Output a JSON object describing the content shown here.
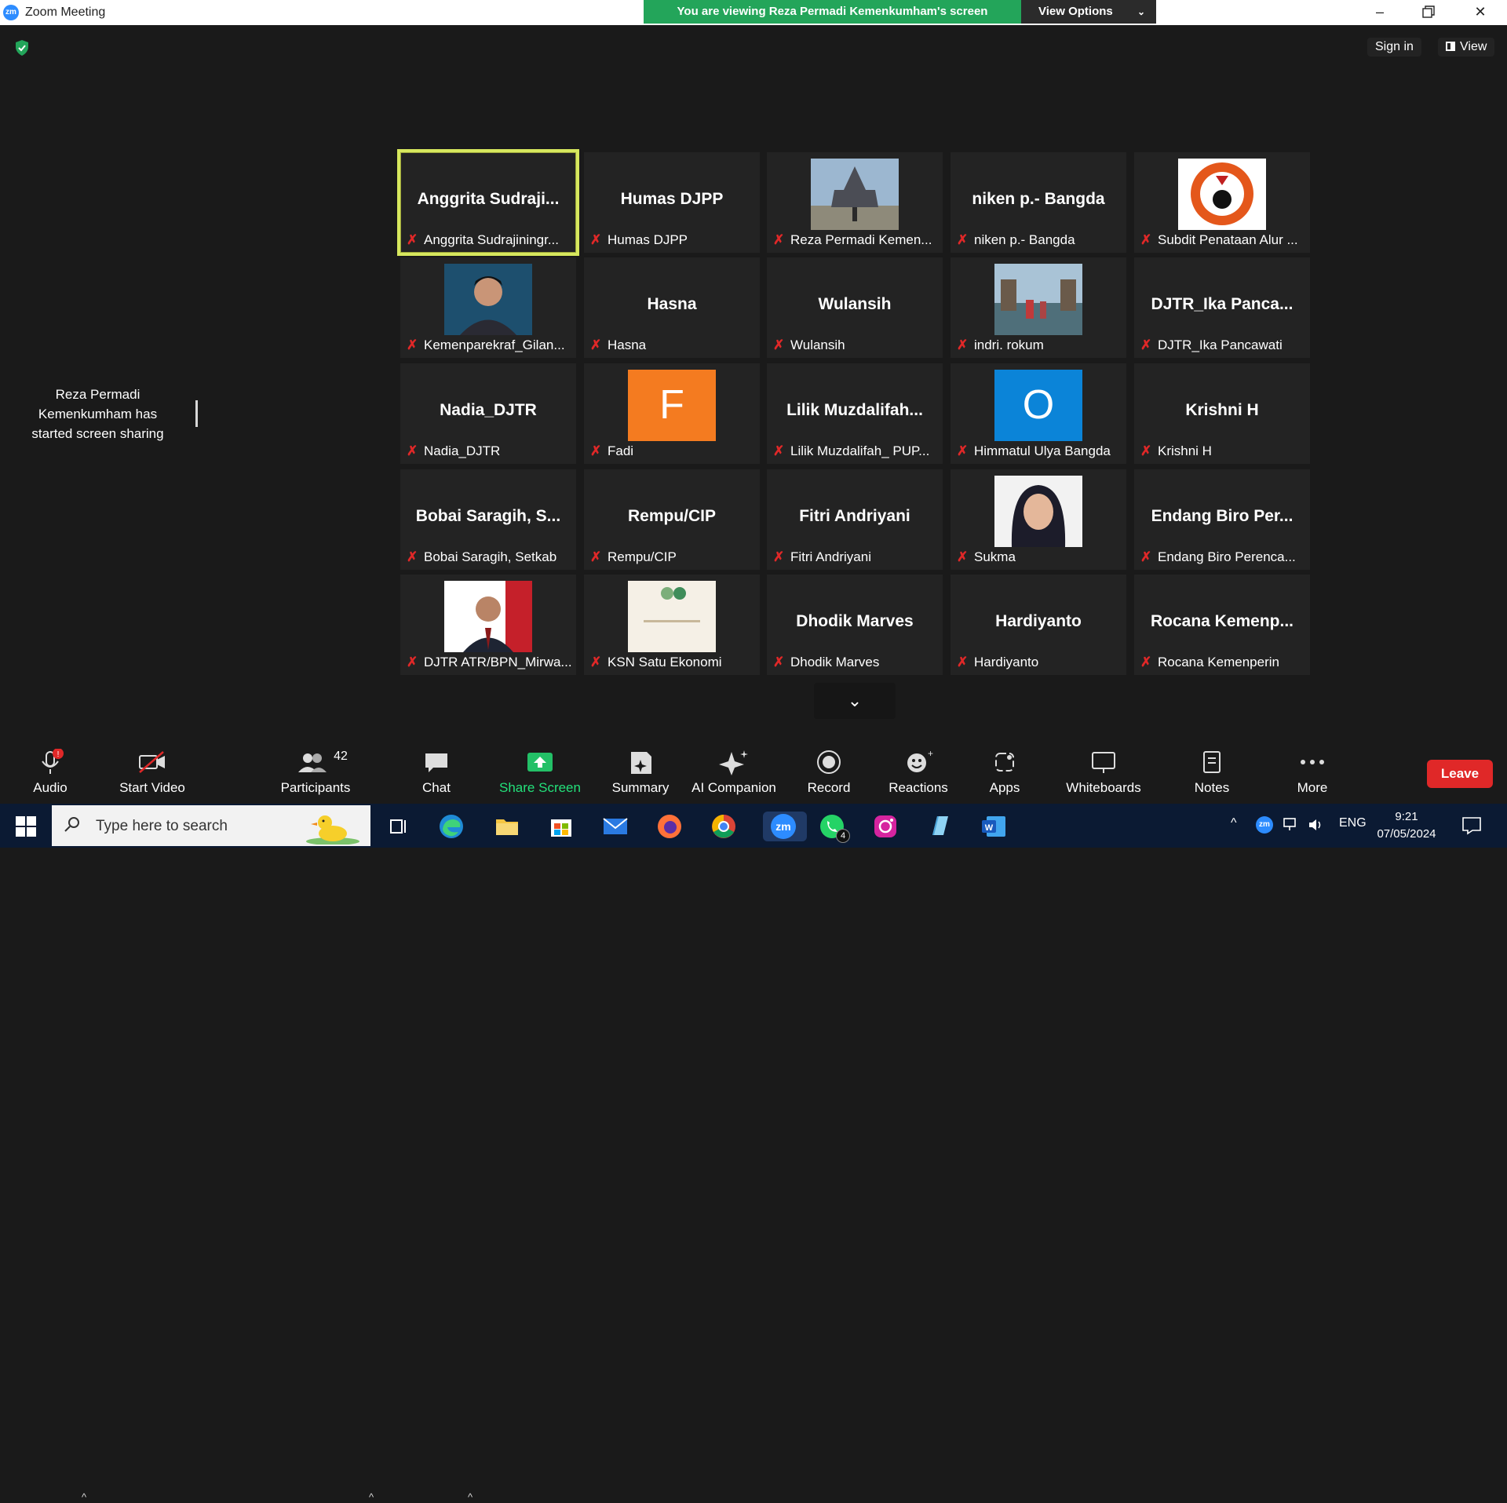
{
  "titlebar": {
    "app_logo": "zm",
    "title": "Zoom Meeting",
    "banner": "You are viewing Reza Permadi Kemenkumham's screen",
    "view_options": "View Options"
  },
  "topright": {
    "sign_in": "Sign in",
    "view": "View"
  },
  "notification": "Reza Permadi Kemenkumham has started screen sharing",
  "tiles": [
    {
      "name": "Anggrita Sudraji...",
      "caption": "Anggrita Sudrajiningr..."
    },
    {
      "name": "Humas DJPP",
      "caption": "Humas DJPP"
    },
    {
      "name": "",
      "caption": "Reza Permadi Kemen..."
    },
    {
      "name": "niken p.- Bangda",
      "caption": "niken p.- Bangda"
    },
    {
      "name": "",
      "caption": "Subdit Penataan Alur ..."
    },
    {
      "name": "",
      "caption": "Kemenparekraf_Gilan..."
    },
    {
      "name": "Hasna",
      "caption": "Hasna"
    },
    {
      "name": "Wulansih",
      "caption": "Wulansih"
    },
    {
      "name": "",
      "caption": "indri. rokum"
    },
    {
      "name": "DJTR_Ika Panca...",
      "caption": "DJTR_Ika Pancawati"
    },
    {
      "name": "Nadia_DJTR",
      "caption": "Nadia_DJTR"
    },
    {
      "name": "F",
      "caption": "Fadi"
    },
    {
      "name": "Lilik Muzdalifah...",
      "caption": "Lilik Muzdalifah_ PUP..."
    },
    {
      "name": "O",
      "caption": "Himmatul Ulya Bangda"
    },
    {
      "name": "Krishni H",
      "caption": "Krishni H"
    },
    {
      "name": "Bobai Saragih, S...",
      "caption": "Bobai Saragih, Setkab"
    },
    {
      "name": "Rempu/CIP",
      "caption": "Rempu/CIP"
    },
    {
      "name": "Fitri Andriyani",
      "caption": "Fitri Andriyani"
    },
    {
      "name": "",
      "caption": "Sukma"
    },
    {
      "name": "Endang Biro Per...",
      "caption": "Endang Biro Perenca..."
    },
    {
      "name": "",
      "caption": "DJTR ATR/BPN_Mirwa..."
    },
    {
      "name": "",
      "caption": "KSN Satu Ekonomi"
    },
    {
      "name": "Dhodik Marves",
      "caption": "Dhodik Marves"
    },
    {
      "name": "Hardiyanto",
      "caption": "Hardiyanto"
    },
    {
      "name": "Rocana Kemenp...",
      "caption": "Rocana Kemenperin"
    }
  ],
  "toolbar": {
    "audio": "Audio",
    "audio_badge": "!",
    "start_video": "Start Video",
    "participants": "Participants",
    "participants_count": "42",
    "chat": "Chat",
    "share_screen": "Share Screen",
    "summary": "Summary",
    "ai_companion": "AI Companion",
    "record": "Record",
    "reactions": "Reactions",
    "apps": "Apps",
    "whiteboards": "Whiteboards",
    "notes": "Notes",
    "more": "More",
    "leave": "Leave"
  },
  "taskbar": {
    "search_placeholder": "Type here to search",
    "whatsapp_badge": "4",
    "language": "ENG",
    "time": "9:21",
    "date": "07/05/2024",
    "zoom_label": "zm"
  },
  "colors": {
    "share_green": "#23a55a",
    "leave_red": "#e02828",
    "active_speaker": "#d7e85e",
    "fadi_avatar": "#f47b20",
    "himmatul_avatar": "#0b84d8"
  }
}
